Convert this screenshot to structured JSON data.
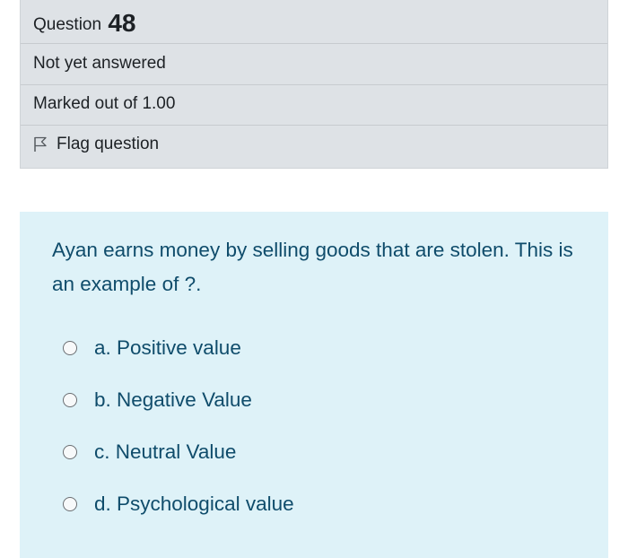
{
  "question": {
    "label": "Question",
    "number": "48",
    "status": "Not yet answered",
    "grade": "Marked out of 1.00",
    "flag_label": "Flag question",
    "flag_icon": "flag-outline-icon",
    "text": "Ayan earns money by selling goods that are stolen. This is an example of ?.",
    "answers": [
      {
        "label": "a. Positive value"
      },
      {
        "label": "b. Negative Value"
      },
      {
        "label": "c. Neutral Value"
      },
      {
        "label": "d. Psychological value"
      }
    ]
  },
  "colors": {
    "info_background": "#dee2e6",
    "question_background": "#def2f8",
    "question_text": "#0f4c6b"
  }
}
